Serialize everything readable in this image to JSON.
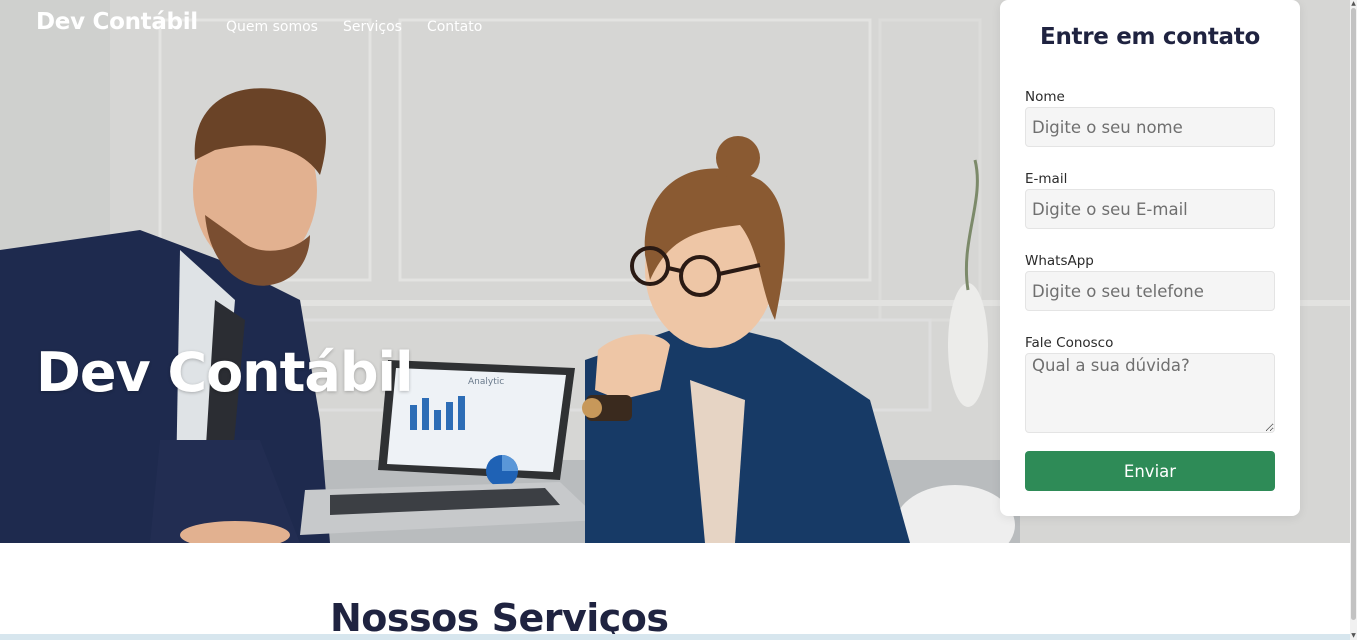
{
  "nav": {
    "brand": "Dev Contábil",
    "links": [
      "Quem somos",
      "Serviços",
      "Contato"
    ]
  },
  "hero": {
    "title": "Dev Contábil",
    "laptop_screen_text": "Analytic"
  },
  "contact_form": {
    "title": "Entre em contato",
    "fields": [
      {
        "label": "Nome",
        "placeholder": "Digite o seu nome"
      },
      {
        "label": "E-mail",
        "placeholder": "Digite o seu E-mail"
      },
      {
        "label": "WhatsApp",
        "placeholder": "Digite o seu telefone"
      },
      {
        "label": "Fale Conosco",
        "placeholder": "Qual a sua dúvida?"
      }
    ],
    "submit_label": "Enviar"
  },
  "services": {
    "title": "Nossos Serviços"
  },
  "colors": {
    "accent_green": "#2e8b57",
    "heading_navy": "#1f2340",
    "hero_text": "#ffffff"
  }
}
